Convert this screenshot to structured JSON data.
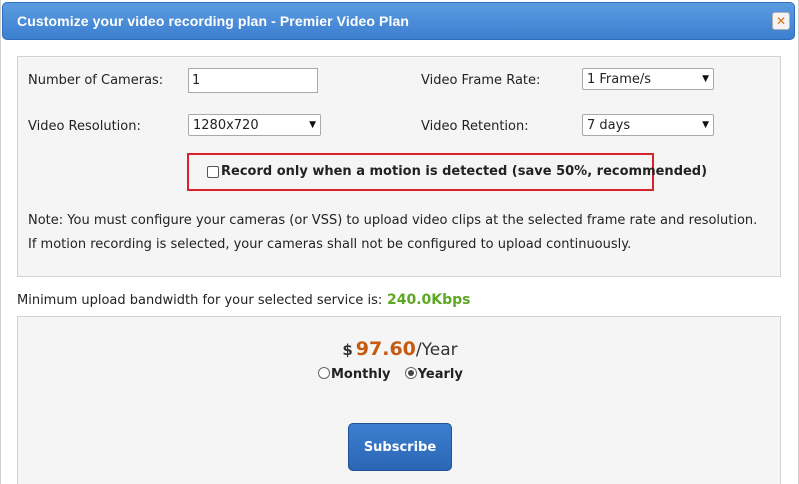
{
  "dialog": {
    "title": "Customize your video recording plan - Premier Video Plan",
    "close_icon": "close-icon",
    "close_glyph": "✕"
  },
  "form": {
    "cameras_label": "Number of Cameras:",
    "cameras_value": "1",
    "resolution_label": "Video Resolution:",
    "resolution_value": "1280x720",
    "frame_rate_label": "Video Frame Rate:",
    "frame_rate_value": "1 Frame/s",
    "retention_label": "Video Retention:",
    "retention_value": "7 days",
    "motion_label": "Record only when a motion is detected (save 50%, recommended)",
    "motion_checked": false,
    "note": "Note: You must configure your cameras (or VSS) to upload video clips at the selected frame rate and resolution. If motion recording is selected, your cameras shall not be configured to upload continuously."
  },
  "bandwidth": {
    "label": "Minimum upload bandwidth for your selected service is:",
    "value": "240.0Kbps",
    "value_color": "#5da822"
  },
  "pricing": {
    "currency": "$",
    "amount": "97.60",
    "period": "/Year",
    "amount_color": "#c55a11",
    "options": [
      {
        "label": "Monthly",
        "selected": false
      },
      {
        "label": "Yearly",
        "selected": true
      }
    ],
    "subscribe_label": "Subscribe"
  },
  "colors": {
    "titlebar": "#3d7fd0",
    "highlight_border": "#d9232c"
  }
}
